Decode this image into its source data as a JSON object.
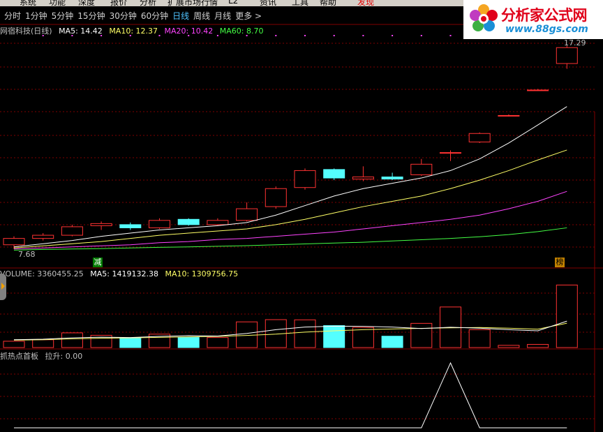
{
  "menu": {
    "items": [
      "系统",
      "功能",
      "深度",
      "报价",
      "分析",
      "扩展市场行情",
      "L2",
      "资讯",
      "工具",
      "帮助",
      "发现"
    ]
  },
  "periods": {
    "items": [
      "分时",
      "1分钟",
      "5分钟",
      "15分钟",
      "30分钟",
      "60分钟",
      "日线",
      "周线",
      "月线",
      "更多 >"
    ],
    "selected": "日线"
  },
  "logo": {
    "title": "分析家公式网",
    "url": "www.88gs.com"
  },
  "price_panel": {
    "stock": "网宿科技(日线)",
    "ma5": "MA5: 14.42",
    "ma10": "MA10: 12.37",
    "ma20": "MA20: 10.42",
    "ma60": "MA60: 8.70",
    "high_label": "17.29",
    "low_label": "7.68",
    "tag_left": "减",
    "tag_right": "榜"
  },
  "volume_panel": {
    "vol": "VOLUME: 3360455.25",
    "ma5": "MA5: 1419132.38",
    "ma10": "MA10: 1309756.75"
  },
  "indicator_panel": {
    "name": "抓热点首板",
    "value": "拉升: 0.00"
  },
  "colors": {
    "up": "#ff3232",
    "down": "#54ffff",
    "ma5": "#ffffff",
    "ma10": "#ffff66",
    "ma20": "#ff44ff",
    "ma60": "#44ff44",
    "grid": "#800000",
    "selected": "#4fc3ff"
  },
  "chart_data": {
    "type": "candlestick",
    "price_ylim": [
      7.2,
      17.8
    ],
    "candles": [
      {
        "o": 7.9,
        "c": 8.2,
        "h": 8.3,
        "l": 7.7
      },
      {
        "o": 8.2,
        "c": 8.35,
        "h": 8.45,
        "l": 8.1
      },
      {
        "o": 8.35,
        "c": 8.75,
        "h": 8.85,
        "l": 8.3
      },
      {
        "o": 8.8,
        "c": 8.9,
        "h": 9.0,
        "l": 8.6
      },
      {
        "o": 8.85,
        "c": 8.7,
        "h": 8.95,
        "l": 8.6
      },
      {
        "o": 8.7,
        "c": 9.05,
        "h": 9.15,
        "l": 8.65
      },
      {
        "o": 9.1,
        "c": 8.85,
        "h": 9.15,
        "l": 8.8
      },
      {
        "o": 8.85,
        "c": 9.05,
        "h": 9.15,
        "l": 8.8
      },
      {
        "o": 9.05,
        "c": 9.6,
        "h": 9.9,
        "l": 9.0
      },
      {
        "o": 9.7,
        "c": 10.55,
        "h": 10.65,
        "l": 9.6
      },
      {
        "o": 10.6,
        "c": 11.4,
        "h": 11.5,
        "l": 10.5
      },
      {
        "o": 11.45,
        "c": 11.05,
        "h": 11.5,
        "l": 10.95
      },
      {
        "o": 11.0,
        "c": 11.1,
        "h": 11.6,
        "l": 10.9
      },
      {
        "o": 11.1,
        "c": 11.0,
        "h": 11.3,
        "l": 10.95
      },
      {
        "o": 11.2,
        "c": 11.7,
        "h": 11.95,
        "l": 11.15
      },
      {
        "o": 12.25,
        "c": 12.25,
        "h": 12.35,
        "l": 11.85
      },
      {
        "o": 12.75,
        "c": 13.15,
        "h": 13.2,
        "l": 12.7
      },
      {
        "o": 14.0,
        "c": 14.0,
        "h": 14.05,
        "l": 13.95
      },
      {
        "o": 15.2,
        "c": 15.2,
        "h": 15.25,
        "l": 15.15
      },
      {
        "o": 16.45,
        "c": 17.2,
        "h": 17.29,
        "l": 16.2
      }
    ],
    "ma5": [
      7.8,
      7.95,
      8.1,
      8.3,
      8.45,
      8.6,
      8.7,
      8.8,
      8.95,
      9.3,
      9.75,
      10.2,
      10.55,
      10.8,
      11.05,
      11.4,
      11.95,
      12.7,
      13.55,
      14.42
    ],
    "ma10": [
      7.75,
      7.85,
      7.95,
      8.05,
      8.2,
      8.35,
      8.45,
      8.55,
      8.65,
      8.85,
      9.1,
      9.4,
      9.7,
      9.95,
      10.2,
      10.55,
      10.95,
      11.4,
      11.9,
      12.37
    ],
    "ma20": [
      7.7,
      7.75,
      7.8,
      7.85,
      7.9,
      8.0,
      8.05,
      8.15,
      8.2,
      8.3,
      8.4,
      8.5,
      8.65,
      8.8,
      8.95,
      9.1,
      9.3,
      9.6,
      9.95,
      10.42
    ],
    "ma60": [
      7.65,
      7.68,
      7.7,
      7.72,
      7.75,
      7.78,
      7.8,
      7.83,
      7.86,
      7.9,
      7.94,
      7.98,
      8.02,
      8.08,
      8.14,
      8.2,
      8.28,
      8.38,
      8.52,
      8.7
    ],
    "volume": [
      340000,
      420000,
      790000,
      660000,
      500000,
      720000,
      540000,
      540000,
      1380000,
      1500000,
      1490000,
      1180000,
      1080000,
      610000,
      1300000,
      2180000,
      960000,
      120000,
      170000,
      3360455.25
    ],
    "vol_ylim": [
      0,
      3600000
    ],
    "vol_ma5": [
      420000,
      450000,
      520000,
      560000,
      540000,
      600000,
      640000,
      620000,
      760000,
      960000,
      1100000,
      1150000,
      1140000,
      1100000,
      1020000,
      1090000,
      1040000,
      960000,
      900000,
      1419132.38
    ],
    "vol_ma10": [
      400000,
      420000,
      470000,
      500000,
      520000,
      550000,
      570000,
      600000,
      650000,
      720000,
      830000,
      900000,
      960000,
      1000000,
      1030000,
      1060000,
      1080000,
      1040000,
      990000,
      1309756.75
    ],
    "indicator": [
      0,
      0,
      0,
      0,
      0,
      0,
      0,
      0,
      0,
      0,
      0,
      0,
      0,
      0,
      0,
      1,
      0,
      0,
      0,
      0
    ],
    "ind_ylim": [
      0,
      1
    ]
  }
}
